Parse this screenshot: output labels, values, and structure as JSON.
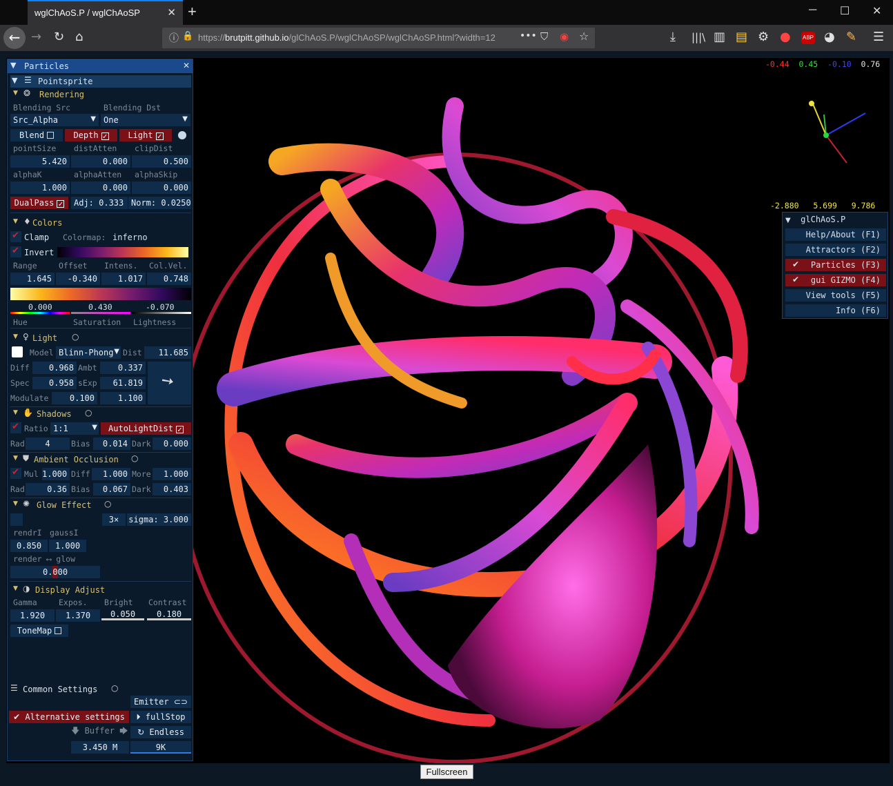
{
  "browser": {
    "tab_title": "wglChAoS.P / wglChAoSP",
    "url_pre": "https://",
    "url_host": "brutpitt.github.io",
    "url_path": "/glChAoS.P/wglChAoSP/wglChAoSP.html?width=12"
  },
  "axes_top": {
    "x": "-0.44",
    "y": "0.45",
    "z": "-0.10",
    "w": "0.76"
  },
  "coords": {
    "x": "-2.880",
    "y": "5.699",
    "z": "9.786"
  },
  "panel": {
    "title": "Particles",
    "pointsprite": "Pointsprite",
    "rendering": {
      "header": "Rendering",
      "blend_src_label": "Blending Src",
      "blend_dst_label": "Blending Dst",
      "blend_src": "Src_Alpha",
      "blend_dst": "One",
      "blend": "Blend",
      "depth": "Depth",
      "light": "Light",
      "l_pointsize": "pointSize",
      "l_distatten": "distAtten",
      "l_clipdist": "clipDist",
      "pointsize": "5.420",
      "distatten": "0.000",
      "clipdist": "0.500",
      "l_alphak": "alphaK",
      "l_alphaatten": "alphaAtten",
      "l_alphaskip": "alphaSkip",
      "alphak": "1.000",
      "alphaatten": "0.000",
      "alphaskip": "0.000",
      "dualpass": "DualPass",
      "adj": "Adj: 0.333",
      "norm": "Norm: 0.0250"
    },
    "colors": {
      "header": "Colors",
      "clamp": "Clamp",
      "colormap_label": "Colormap:",
      "colormap": "inferno",
      "invert": "Invert",
      "l_range": "Range",
      "l_offset": "Offset",
      "l_intens": "Intens.",
      "l_colvel": "Col.Vel.",
      "range": "1.645",
      "offset": "-0.340",
      "intens": "1.017",
      "colvel": "0.748",
      "hue": "0.000",
      "saturation": "0.430",
      "lightness": "-0.070",
      "l_hue": "Hue",
      "l_sat": "Saturation",
      "l_light": "Lightness"
    },
    "light": {
      "header": "Light",
      "model_label": "Model",
      "model": "Blinn-Phong",
      "dist_label": "Dist",
      "dist": "11.685",
      "diff_label": "Diff",
      "diff": "0.968",
      "ambt_label": "Ambt",
      "ambt": "0.337",
      "spec_label": "Spec",
      "spec": "0.958",
      "sexp_label": "sExp",
      "sexp": "61.819",
      "modulate_label": "Modulate",
      "mod1": "0.100",
      "mod2": "1.100"
    },
    "shadows": {
      "header": "Shadows",
      "ratio_label": "Ratio",
      "ratio": "1:1",
      "autolight": "AutoLightDist",
      "rad_label": "Rad",
      "rad": "4",
      "bias_label": "Bias",
      "bias": "0.014",
      "dark_label": "Dark",
      "dark": "0.000"
    },
    "ao": {
      "header": "Ambient Occlusion",
      "mul_label": "Mul",
      "mul": "1.000",
      "diff_label": "Diff",
      "diff": "1.000",
      "more_label": "More",
      "more": "1.000",
      "rad_label": "Rad",
      "rad": "0.36",
      "bias_label": "Bias",
      "bias": "0.067",
      "dark_label": "Dark",
      "dark": "0.403"
    },
    "glow": {
      "header": "Glow Effect",
      "mult": "3×",
      "sigma": "sigma: 3.000",
      "l_rendri": "rendrI",
      "l_gaussi": "gaussI",
      "rendri": "0.850",
      "gaussi": "1.000",
      "l_mix": "render ⟷ glow",
      "mix": "0.000"
    },
    "display": {
      "header": "Display Adjust",
      "l_gamma": "Gamma",
      "l_expos": "Expos.",
      "l_bright": "Bright",
      "l_contrast": "Contrast",
      "gamma": "1.920",
      "expos": "1.370",
      "bright": "0.050",
      "contrast": "0.180",
      "tonemap": "ToneMap"
    },
    "common": {
      "header": "Common Settings",
      "emitter": "Emitter",
      "alt": "Alternative settings",
      "fullstop": "fullStop",
      "buffer": "Buffer",
      "endless": "Endless",
      "buffer_val": "3.450 M",
      "count": "9K"
    }
  },
  "menu": {
    "title": "glChAoS.P",
    "items": [
      "Help/About (F1)",
      "Attractors (F2)",
      "Particles (F3)",
      "gui GIZMO (F4)",
      "View tools (F5)",
      "Info (F6)"
    ]
  },
  "fullscreen": "Fullscreen",
  "colors": {
    "accent_red": "#7a1117",
    "field": "#0f2c4a",
    "header": "#173a60"
  }
}
